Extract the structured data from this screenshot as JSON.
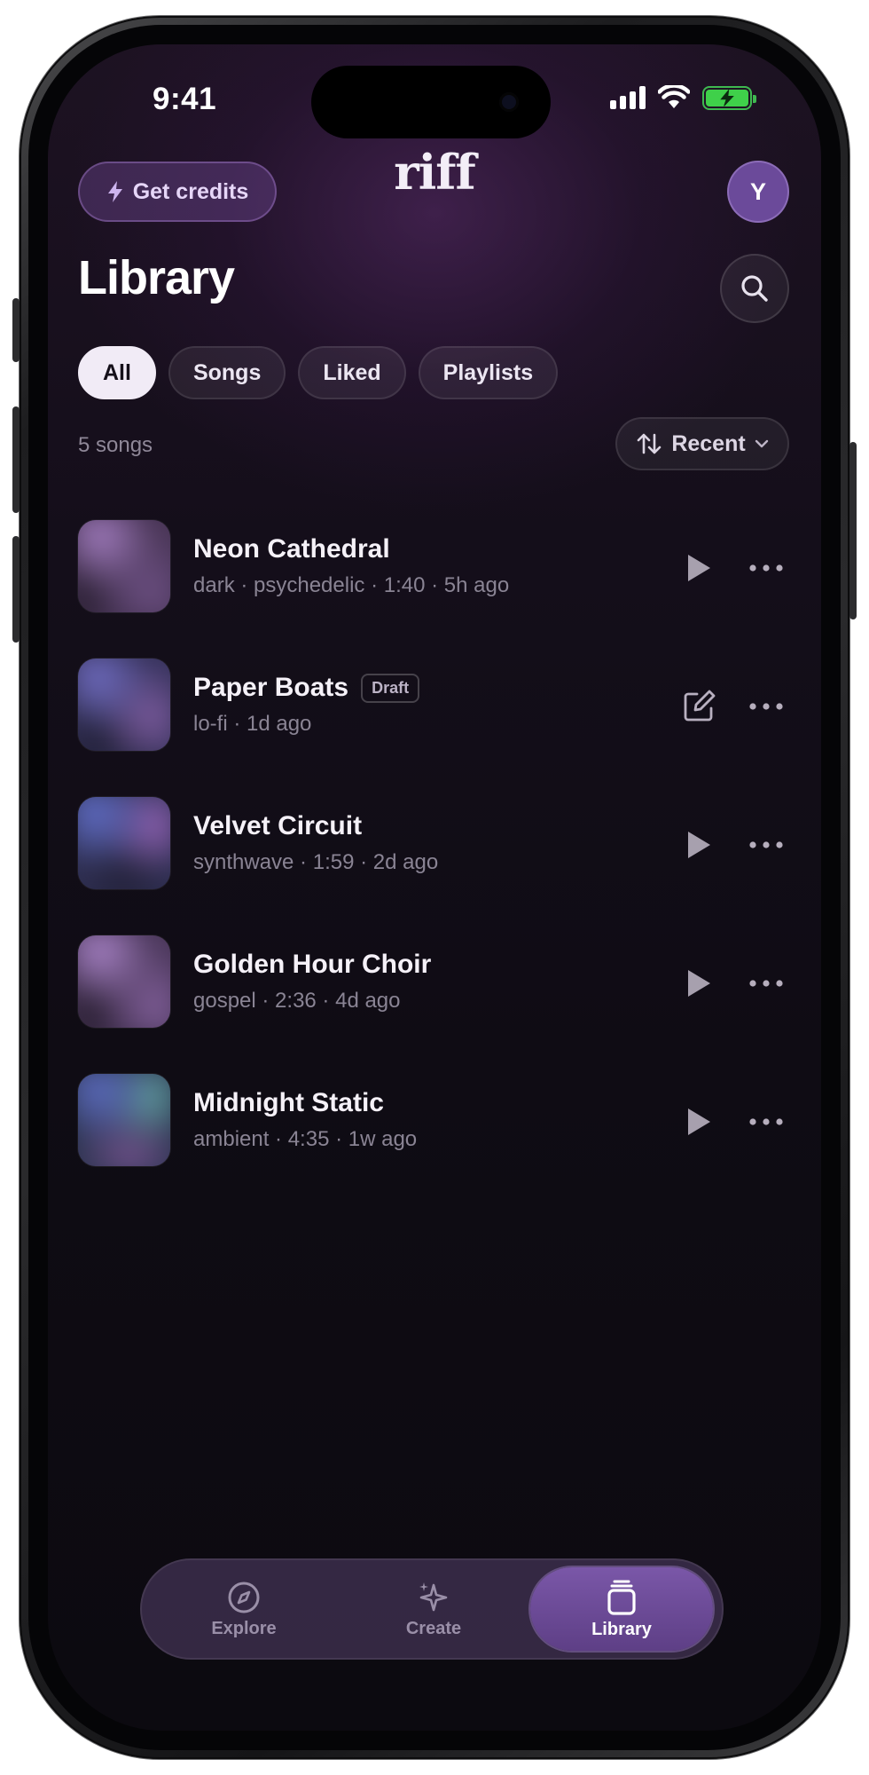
{
  "status": {
    "time": "9:41"
  },
  "header": {
    "credits_label": "Get credits",
    "logo": "riff",
    "avatar_initial": "Y"
  },
  "page": {
    "title": "Library"
  },
  "filters": [
    {
      "label": "All",
      "active": true
    },
    {
      "label": "Songs",
      "active": false
    },
    {
      "label": "Liked",
      "active": false
    },
    {
      "label": "Playlists",
      "active": false
    }
  ],
  "list": {
    "count_label": "5 songs",
    "sort_label": "Recent"
  },
  "songs": [
    {
      "title": "Neon Cathedral",
      "meta": "dark · psychedelic · 1:40 · 5h ago",
      "badge": "",
      "action": "play-icon"
    },
    {
      "title": "Paper Boats",
      "meta": "lo-fi · 1d ago",
      "badge": "Draft",
      "action": "edit-icon"
    },
    {
      "title": "Velvet Circuit",
      "meta": "synthwave · 1:59 · 2d ago",
      "badge": "",
      "action": "play-icon"
    },
    {
      "title": "Golden Hour Choir",
      "meta": "gospel · 2:36 · 4d ago",
      "badge": "",
      "action": "play-icon"
    },
    {
      "title": "Midnight Static",
      "meta": "ambient · 4:35 · 1w ago",
      "badge": "",
      "action": "play-icon"
    }
  ],
  "tabs": [
    {
      "label": "Explore",
      "icon": "compass-icon",
      "active": false
    },
    {
      "label": "Create",
      "icon": "sparkle-icon",
      "active": false
    },
    {
      "label": "Library",
      "icon": "stack-icon",
      "active": true
    }
  ],
  "colors": {
    "accent": "#6b4a9a",
    "background": "#0f0c14",
    "chip_active": "#f1ebf6"
  }
}
